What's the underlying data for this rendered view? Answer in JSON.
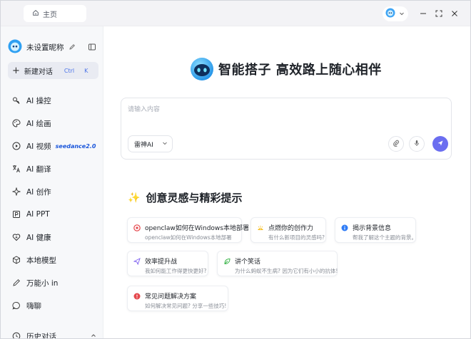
{
  "titlebar": {
    "home_tab": "主页"
  },
  "sidebar": {
    "profile_name": "未设置昵称",
    "new_chat": {
      "label": "新建对话",
      "kbd1": "Ctrl",
      "kbd2": "K"
    },
    "items": [
      {
        "label": "AI 操控",
        "icon": "control-icon"
      },
      {
        "label": "AI 绘画",
        "icon": "palette-icon"
      },
      {
        "label": "AI 视频",
        "icon": "play-icon",
        "badge": "seedance2.0"
      },
      {
        "label": "AI 翻译",
        "icon": "translate-icon"
      },
      {
        "label": "AI 创作",
        "icon": "sparkle-icon"
      },
      {
        "label": "AI PPT",
        "icon": "ppt-icon"
      },
      {
        "label": "AI 健康",
        "icon": "health-icon"
      },
      {
        "label": "本地模型",
        "icon": "cube-icon"
      },
      {
        "label": "万能小 in",
        "icon": "pen-icon"
      },
      {
        "label": "嗨聊",
        "icon": "chat-icon"
      }
    ],
    "history_label": "历史对话"
  },
  "main": {
    "hero_title": "智能搭子 高效路上随心相伴",
    "prompt_placeholder": "请输入内容",
    "model_label": "雷神AI",
    "section_title": "创意灵感与精彩提示",
    "cards": [
      {
        "title": "openclaw如何在Windows本地部署",
        "sub": "openclaw如何在Windows本地部署",
        "icon": "stop-icon",
        "color": "#e5484d"
      },
      {
        "title": "点燃你的创作力",
        "sub": "有什么新项目的灵感吗?",
        "icon": "sunrise-icon",
        "color": "#f5b400"
      },
      {
        "title": "揭示背景信息",
        "sub": "帮我了解这个主题的背景。",
        "icon": "info-icon",
        "color": "#2f7cf6"
      },
      {
        "title": "效率提升战",
        "sub": "我如何能工作得更快更好?",
        "icon": "send-icon",
        "color": "#7b5cf0"
      },
      {
        "title": "讲个笑话",
        "sub": "为什么蚂蚁不生病? 因为它们有小小的抗体!",
        "icon": "leaf-icon",
        "color": "#3bb54a"
      },
      {
        "title": "常见问题解决方案",
        "sub": "如何解决常见问题? 分享一些技巧!",
        "icon": "alert-icon",
        "color": "#e5484d"
      }
    ]
  },
  "colors": {
    "accent": "#6b6ef0",
    "sidebar_bg": "#f7f8fa",
    "titlebar_bg": "#f3f3f6"
  }
}
